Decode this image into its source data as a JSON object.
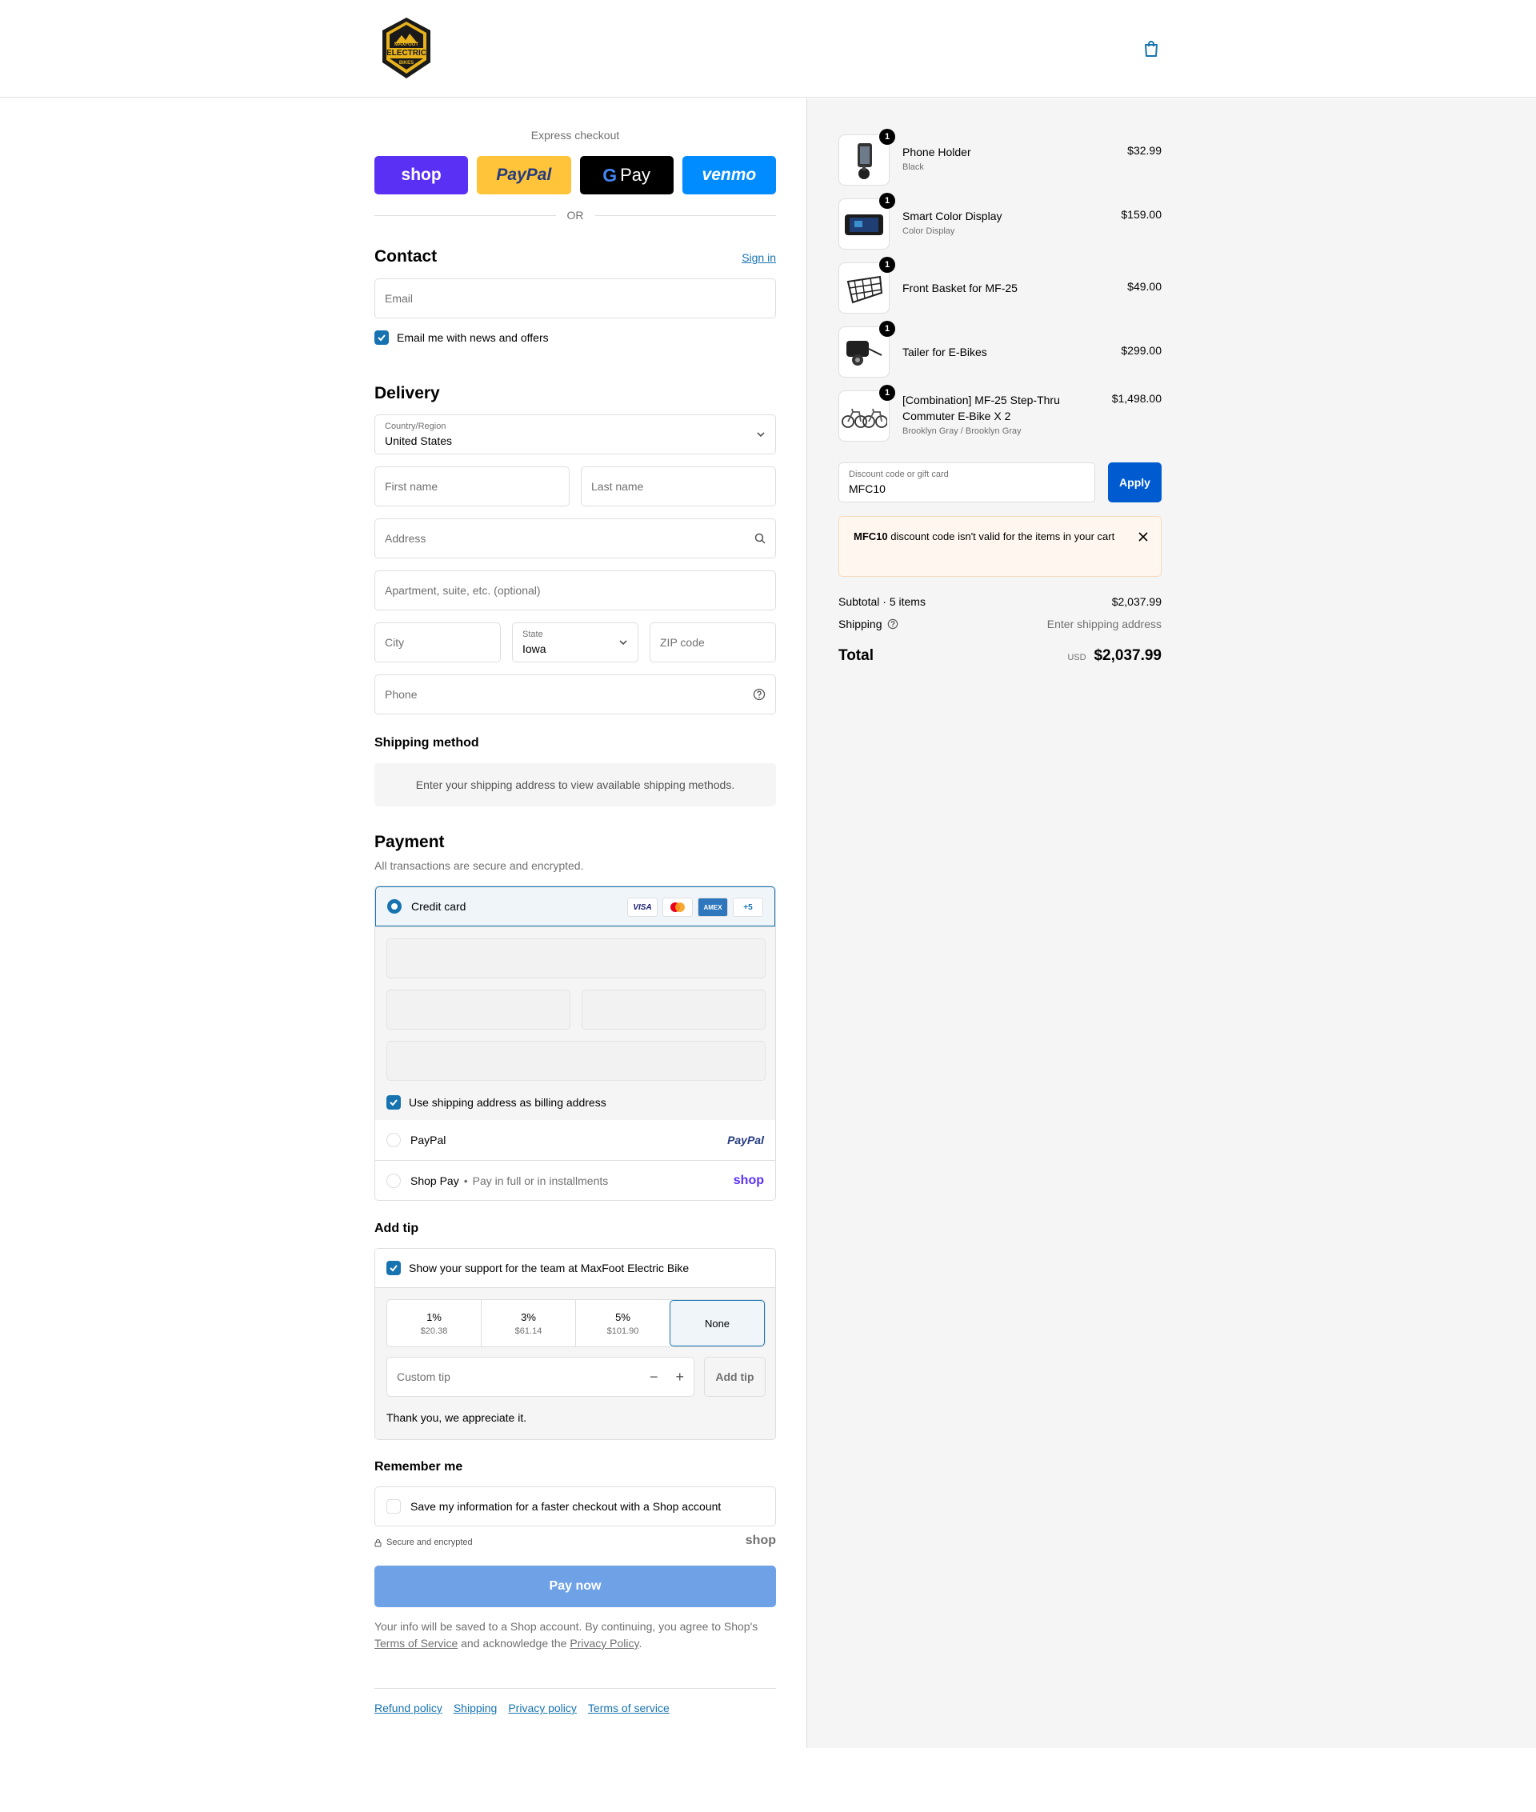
{
  "brand": {
    "logo_top": "MAXFOOT",
    "logo_main": "ELECTRIC",
    "logo_bottom": "BIKES"
  },
  "express": {
    "title": "Express checkout",
    "shop_label": "shop",
    "paypal_label": "PayPal",
    "gpay_label": "Pay",
    "venmo_label": "venmo",
    "or_label": "OR"
  },
  "contact": {
    "heading": "Contact",
    "sign_in": "Sign in",
    "email_placeholder": "Email",
    "newsletter_label": "Email me with news and offers",
    "newsletter_checked": true
  },
  "delivery": {
    "heading": "Delivery",
    "country_label": "Country/Region",
    "country_value": "United States",
    "first_name_placeholder": "First name",
    "last_name_placeholder": "Last name",
    "address_placeholder": "Address",
    "apartment_placeholder": "Apartment, suite, etc. (optional)",
    "city_placeholder": "City",
    "state_label": "State",
    "state_value": "Iowa",
    "zip_placeholder": "ZIP code",
    "phone_placeholder": "Phone"
  },
  "shipping_method": {
    "heading": "Shipping method",
    "message": "Enter your shipping address to view available shipping methods."
  },
  "payment": {
    "heading": "Payment",
    "subtitle": "All transactions are secure and encrypted.",
    "credit_card_label": "Credit card",
    "card_brands": [
      "VISA",
      "Mastercard",
      "AMEX",
      "+5"
    ],
    "billing_same_label": "Use shipping address as billing address",
    "paypal_label": "PayPal",
    "paypal_logo": "PayPal",
    "shoppay_label": "Shop Pay",
    "shoppay_sub": "Pay in full or in installments",
    "shoppay_logo": "shop"
  },
  "tip": {
    "heading": "Add tip",
    "support_label": "Show your support for the team at MaxFoot Electric Bike",
    "options": [
      {
        "pct": "1%",
        "amount": "$20.38"
      },
      {
        "pct": "3%",
        "amount": "$61.14"
      },
      {
        "pct": "5%",
        "amount": "$101.90"
      },
      {
        "pct": "None",
        "amount": ""
      }
    ],
    "custom_placeholder": "Custom tip",
    "add_button": "Add tip",
    "thanks": "Thank you, we appreciate it."
  },
  "remember": {
    "heading": "Remember me",
    "save_label": "Save my information for a faster checkout with a Shop account",
    "secure_label": "Secure and encrypted",
    "shop_logo": "shop"
  },
  "pay_now": "Pay now",
  "legal": {
    "text_1": "Your info will be saved to a Shop account. By continuing, you agree to Shop's",
    "terms_link": "Terms of Service",
    "text_2": "and acknowledge the",
    "privacy_link": "Privacy Policy",
    "text_3": "."
  },
  "footer": [
    "Refund policy",
    "Shipping",
    "Privacy policy",
    "Terms of service"
  ],
  "cart": {
    "items": [
      {
        "name": "Phone Holder",
        "variant": "Black",
        "price": "$32.99",
        "qty": "1"
      },
      {
        "name": "Smart Color Display",
        "variant": "Color Display",
        "price": "$159.00",
        "qty": "1"
      },
      {
        "name": "Front Basket for MF-25",
        "variant": "",
        "price": "$49.00",
        "qty": "1"
      },
      {
        "name": "Tailer for E-Bikes",
        "variant": "",
        "price": "$299.00",
        "qty": "1"
      },
      {
        "name": "[Combination] MF-25 Step-Thru Commuter E-Bike X 2",
        "variant": "Brooklyn Gray / Brooklyn Gray",
        "price": "$1,498.00",
        "qty": "1"
      }
    ],
    "discount_label": "Discount code or gift card",
    "discount_value": "MFC10",
    "apply": "Apply",
    "error_code": "MFC10",
    "error_text": "discount code isn't valid for the items in your cart",
    "subtotal_label": "Subtotal · 5 items",
    "subtotal_value": "$2,037.99",
    "shipping_label": "Shipping",
    "shipping_value": "Enter shipping address",
    "total_label": "Total",
    "currency": "USD",
    "total_value": "$2,037.99"
  },
  "colors": {
    "accent": "#1773b0",
    "apply_blue": "#005bd1",
    "pay_now_disabled": "#6fa1e6",
    "shop_purple": "#5a31f4",
    "paypal_yellow": "#ffc439",
    "venmo_blue": "#008cff"
  }
}
